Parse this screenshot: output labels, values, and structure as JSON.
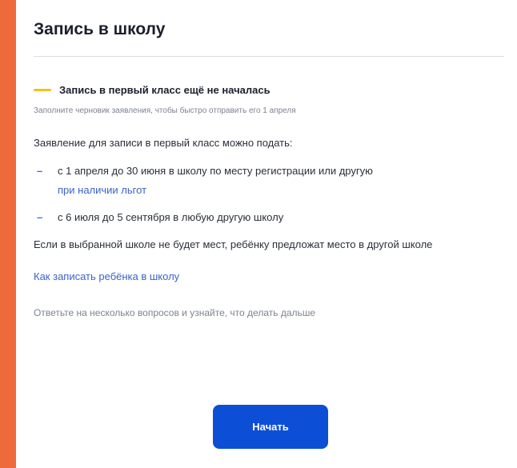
{
  "card": {
    "title": "Запись в школу",
    "status": {
      "text": "Запись в первый класс ещё не началась",
      "hint": "Заполните черновик заявления, чтобы быстро отправить его 1 апреля",
      "color": "#f2c11a"
    },
    "intro": "Заявление для записи в первый класс можно подать:",
    "bullets": [
      {
        "text": "с 1 апреля до 30 июня в школу по месту регистрации или другую",
        "link": "при наличии льгот"
      },
      {
        "text": "с 6 июля до 5 сентября в любую другую школу"
      }
    ],
    "no_place": "Если в выбранной школе не будет мест, ребёнку предложат место в другой школе",
    "how_link": "Как записать ребёнка в школу",
    "questions": "Ответьте на несколько вопросов и узнайте, что делать дальше",
    "start_label": "Начать"
  },
  "colors": {
    "background": "#ef6a3a",
    "link": "#3a63c9",
    "primary": "#0d4ed6"
  }
}
